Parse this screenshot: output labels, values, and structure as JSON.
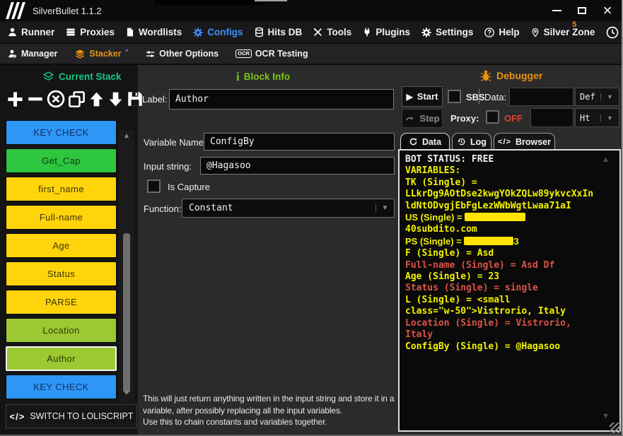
{
  "window": {
    "title": "SilverBullet 1.1.2"
  },
  "menu": {
    "items": [
      {
        "label": "Runner"
      },
      {
        "label": "Proxies"
      },
      {
        "label": "Wordlists"
      },
      {
        "label": "Configs"
      },
      {
        "label": "Hits DB"
      },
      {
        "label": "Tools"
      },
      {
        "label": "Plugins"
      },
      {
        "label": "Settings"
      },
      {
        "label": "Help"
      },
      {
        "label": "Silver Zone",
        "badge": "5"
      }
    ]
  },
  "subnav": {
    "items": [
      {
        "label": "Manager"
      },
      {
        "label": "Stacker",
        "sup": "*"
      },
      {
        "label": "Other Options"
      },
      {
        "label": "OCR Testing",
        "icon_text": "OCR"
      }
    ]
  },
  "sections": {
    "current_stack": "Current Stack",
    "block_info": "Block Info",
    "debugger": "Debugger"
  },
  "icons": {
    "code": "</>"
  },
  "stack": {
    "blocks": [
      {
        "label": "KEY CHECK",
        "color": "blue"
      },
      {
        "label": "Get_Cap",
        "color": "green"
      },
      {
        "label": "first_name",
        "color": "yellow"
      },
      {
        "label": "Full-name",
        "color": "yellow"
      },
      {
        "label": "Age",
        "color": "yellow"
      },
      {
        "label": "Status",
        "color": "yellow"
      },
      {
        "label": "PARSE",
        "color": "yellow"
      },
      {
        "label": "Location",
        "color": "yellowgreen"
      },
      {
        "label": "Author",
        "color": "yellowgreen",
        "selected": true
      },
      {
        "label": "KEY CHECK",
        "color": "blue"
      }
    ],
    "switch_button_label": "SWITCH TO LOLISCRIPT"
  },
  "block_info": {
    "label_caption": "Label:",
    "label_value": "Author",
    "variable_name_caption": "Variable Name:",
    "variable_name_value": "ConfigBy",
    "input_string_caption": "Input string:",
    "input_string_value": "@Hagasoo",
    "is_capture_label": "Is Capture",
    "function_caption": "Function:",
    "function_value": "Constant",
    "description_p1": "This will just return anything written in the input string and store it in a variable, after possibly replacing all the input variables.",
    "description_p2": "Use this to chain constants and variables together."
  },
  "debugger": {
    "start_label": "Start",
    "step_label": "Step",
    "sbs_label": "SBS",
    "data_caption": "Data:",
    "data_value": "",
    "data_type": "Def",
    "proxy_caption": "Proxy:",
    "proxy_status": "OFF",
    "proxy_value": "",
    "proxy_type": "Ht",
    "tabs": [
      {
        "label": "Data"
      },
      {
        "label": "Log"
      },
      {
        "label": "Browser"
      }
    ],
    "log_lines": [
      {
        "text": "BOT STATUS: FREE",
        "color": "white"
      },
      {
        "text": "VARIABLES:",
        "color": "yellow"
      },
      {
        "text": "TK (Single) =",
        "color": "yellow"
      },
      {
        "text": "LLkrDg9AOtDse2kwgYOkZQLw89ykvcXxIn",
        "color": "yellow"
      },
      {
        "text": "ldNtODvgjEbFgLezWWbWgtLwaa71aI",
        "color": "yellow"
      },
      {
        "text": "US (Single) = ",
        "color": "yellow",
        "redacted": true
      },
      {
        "text": "40subdito.com",
        "color": "yellow"
      },
      {
        "text": "PS (Single) = ",
        "color": "yellow",
        "redacted": true,
        "suffix": "3"
      },
      {
        "text": "F (Single) = Asd",
        "color": "yellow"
      },
      {
        "text": "Full-name (Single) = Asd Df",
        "color": "red"
      },
      {
        "text": "Age (Single) = 23",
        "color": "yellow"
      },
      {
        "text": "Status (Single) = single",
        "color": "red"
      },
      {
        "text": "L (Single) = <small",
        "color": "yellow"
      },
      {
        "text": "class=\"w-50\">Vistrorio, Italy",
        "color": "yellow"
      },
      {
        "text": "Location (Single) = Vistrorio,",
        "color": "red"
      },
      {
        "text": "Italy",
        "color": "red"
      },
      {
        "text": "ConfigBy (Single) = @Hagasoo",
        "color": "yellow"
      }
    ]
  },
  "colors": {
    "accent_blue": "#3E8EF7",
    "accent_orange": "#E8920F",
    "accent_teal": "#16C784",
    "accent_green": "#7EC41A",
    "status_off_red": "#E2422F",
    "log_yellow": "#F2F200",
    "log_red": "#DE5246",
    "block_blue": "#2E96F5",
    "block_green": "#2EC53F",
    "block_yellow": "#FFD40A",
    "block_yellowgreen": "#9CC832"
  }
}
